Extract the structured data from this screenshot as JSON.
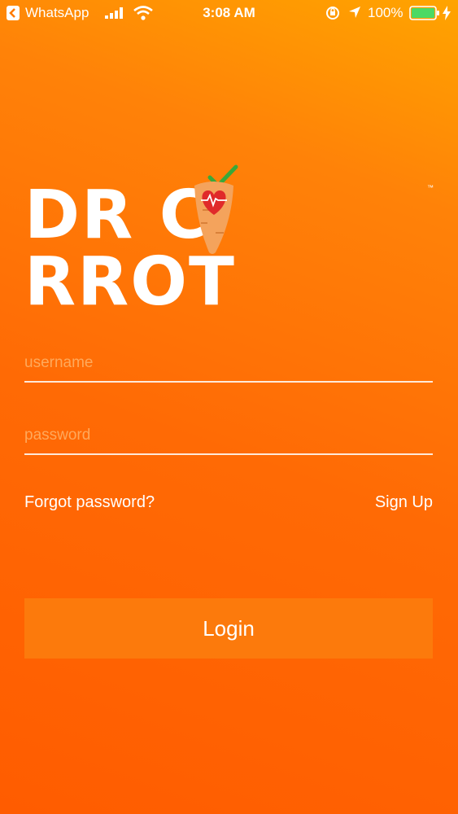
{
  "status_bar": {
    "back_app": "WhatsApp",
    "time": "3:08 AM",
    "battery": "100%",
    "icons": [
      "back-icon",
      "signal-icon",
      "wifi-icon",
      "orientation-lock-icon",
      "location-arrow-icon",
      "battery-icon",
      "charging-bolt-icon"
    ]
  },
  "logo": {
    "text_left": "DR C",
    "text_right": "RROT",
    "trademark": "™",
    "icons": [
      "carrot-heart-icon",
      "checkmark-icon"
    ]
  },
  "login_form": {
    "username_placeholder": "username",
    "password_placeholder": "password",
    "forgot_password_label": "Forgot password?",
    "sign_up_label": "Sign Up",
    "login_label": "Login"
  },
  "colors": {
    "background_top": "#ffa400",
    "background_bottom": "#ff5c00",
    "button": "#fc7a0c",
    "checkmark": "#3aa83a",
    "heart": "#e02a2a"
  }
}
